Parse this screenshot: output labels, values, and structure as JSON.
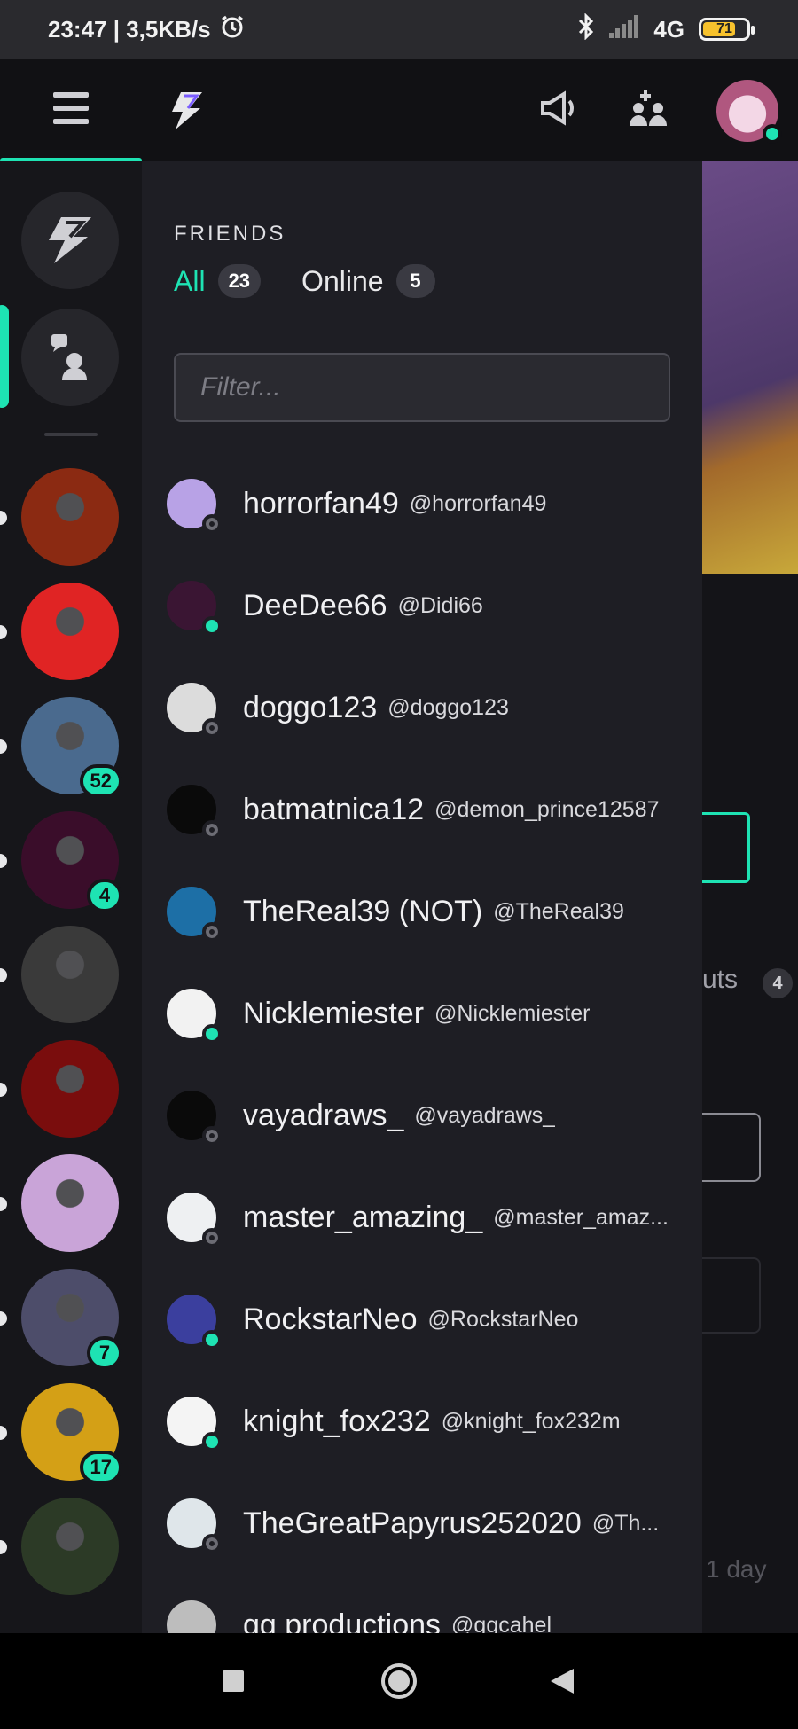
{
  "status_bar": {
    "time_speed": "23:47 | 3,5KB/s",
    "network": "4G",
    "battery": "71",
    "battery_level": 0.71
  },
  "app_bar": {
    "icons": [
      "menu-icon",
      "lightning-logo-icon",
      "megaphone-icon",
      "add-friend-icon",
      "avatar"
    ]
  },
  "friends": {
    "heading": "FRIENDS",
    "tabs": [
      {
        "label": "All",
        "count": "23",
        "active": true
      },
      {
        "label": "Online",
        "count": "5",
        "active": false
      }
    ],
    "filter_placeholder": "Filter...",
    "list": [
      {
        "name": "horrorfan49",
        "handle": "@horrorfan49",
        "online": false,
        "color": "#b8a2e6"
      },
      {
        "name": "DeeDee66",
        "handle": "@Didi66",
        "online": true,
        "color": "#3a1533"
      },
      {
        "name": "doggo123",
        "handle": "@doggo123",
        "online": false,
        "color": "#dcdcdc"
      },
      {
        "name": "batmatnica12",
        "handle": "@demon_prince12587",
        "online": false,
        "color": "#0a0a0a"
      },
      {
        "name": "TheReal39 (NOT)",
        "handle": "@TheReal39",
        "online": false,
        "color": "#1d6fa6"
      },
      {
        "name": "Nicklemiester",
        "handle": "@Nicklemiester",
        "online": true,
        "color": "#f2f2f2"
      },
      {
        "name": "vayadraws_",
        "handle": "@vayadraws_",
        "online": false,
        "color": "#0a0a0a"
      },
      {
        "name": "master_amazing_",
        "handle": "@master_amaz...",
        "online": false,
        "color": "#eef0f2"
      },
      {
        "name": "RockstarNeo",
        "handle": "@RockstarNeo",
        "online": true,
        "color": "#3b3f9e"
      },
      {
        "name": "knight_fox232",
        "handle": "@knight_fox232m",
        "online": true,
        "color": "#f4f4f4"
      },
      {
        "name": "TheGreatPapyrus252020",
        "handle": "@Th...",
        "online": false,
        "color": "#dfe6ea"
      },
      {
        "name": "gg productions",
        "handle": "@ggcahel",
        "online": false,
        "color": "#bdbdbd"
      }
    ]
  },
  "servers": [
    {
      "name": "server-fnaf-freddy",
      "badge": "",
      "color": "#8b2a12"
    },
    {
      "name": "server-fnafers-squad",
      "badge": "",
      "color": "#e02424"
    },
    {
      "name": "server-freddy-hat",
      "badge": "52",
      "color": "#4a6a8e"
    },
    {
      "name": "server-pink-animatronic",
      "badge": "4",
      "color": "#3a0d2a"
    },
    {
      "name": "server-cartoon-cat",
      "badge": "",
      "color": "#3a3a3a"
    },
    {
      "name": "server-bendy-red",
      "badge": "",
      "color": "#7a0d0d"
    },
    {
      "name": "server-funtime-freddy",
      "badge": "",
      "color": "#c9a4d8"
    },
    {
      "name": "server-lolbit",
      "badge": "7",
      "color": "#4d4d6a"
    },
    {
      "name": "server-bendy-yellow",
      "badge": "17",
      "color": "#d4a016"
    },
    {
      "name": "server-springtrap",
      "badge": "",
      "color": "#2c3a26"
    }
  ],
  "background": {
    "fragment_text": "uts",
    "fragment_badge": "4",
    "fragment_day": "1 day"
  }
}
